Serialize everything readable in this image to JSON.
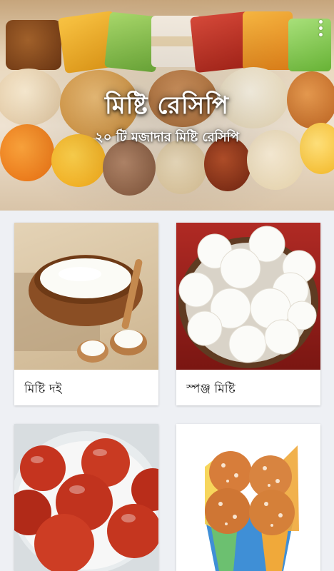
{
  "hero": {
    "title": "মিষ্টি রেসিপি",
    "subtitle": "২০ টি মজাদার মিষ্টি রেসিপি",
    "menu_icon": "overflow-menu-icon"
  },
  "recipes": [
    {
      "name": "মিষ্টি দই",
      "image": "sweet-yogurt-bowl"
    },
    {
      "name": "স্পঞ্জ মিষ্টি",
      "image": "rasgulla-bowl"
    },
    {
      "name": "",
      "image": "gulab-jamun-bowl"
    },
    {
      "name": "",
      "image": "sugar-coated-sweets-glass"
    }
  ],
  "colors": {
    "background": "#eef0f4",
    "card": "#ffffff",
    "text": "#202020"
  }
}
